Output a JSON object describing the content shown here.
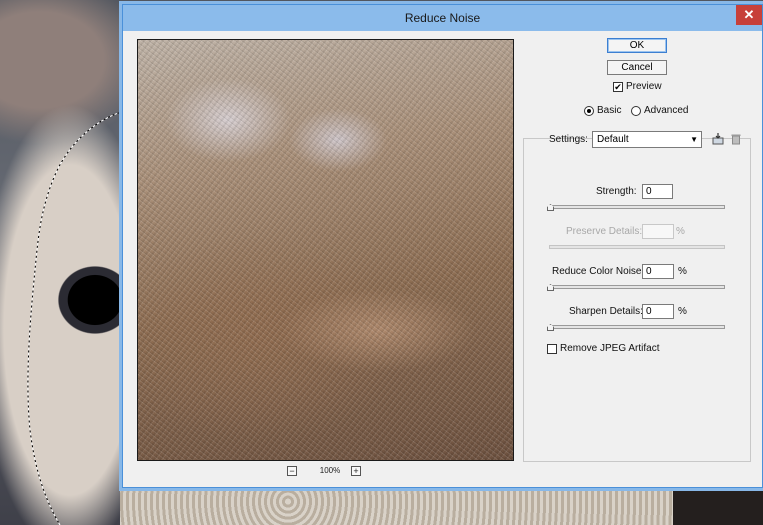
{
  "window": {
    "title": "Reduce Noise",
    "close_label": "✕"
  },
  "buttons": {
    "ok": "OK",
    "cancel": "Cancel"
  },
  "preview": {
    "checked": true,
    "label": "Preview"
  },
  "mode": {
    "basic": "Basic",
    "advanced": "Advanced",
    "selected": "Basic"
  },
  "settings": {
    "label": "Settings:",
    "value": "Default"
  },
  "zoom": {
    "minus": "−",
    "level": "100%",
    "plus": "+"
  },
  "controls": {
    "strength": {
      "label": "Strength:",
      "value": "0",
      "unit": "",
      "level": 0,
      "enabled": true
    },
    "preserve_details": {
      "label": "Preserve Details:",
      "value": "",
      "unit": "%",
      "level": 0,
      "enabled": false
    },
    "reduce_color_noise": {
      "label": "Reduce Color Noise:",
      "value": "0",
      "unit": "%",
      "level": 0,
      "enabled": true
    },
    "sharpen_details": {
      "label": "Sharpen Details:",
      "value": "0",
      "unit": "%",
      "level": 0,
      "enabled": true
    }
  },
  "jpeg": {
    "label": "Remove JPEG Artifact",
    "checked": false
  },
  "colors": {
    "titlebar": "#8bbbeb",
    "close": "#c7403a",
    "accent": "#3c7fd1"
  }
}
